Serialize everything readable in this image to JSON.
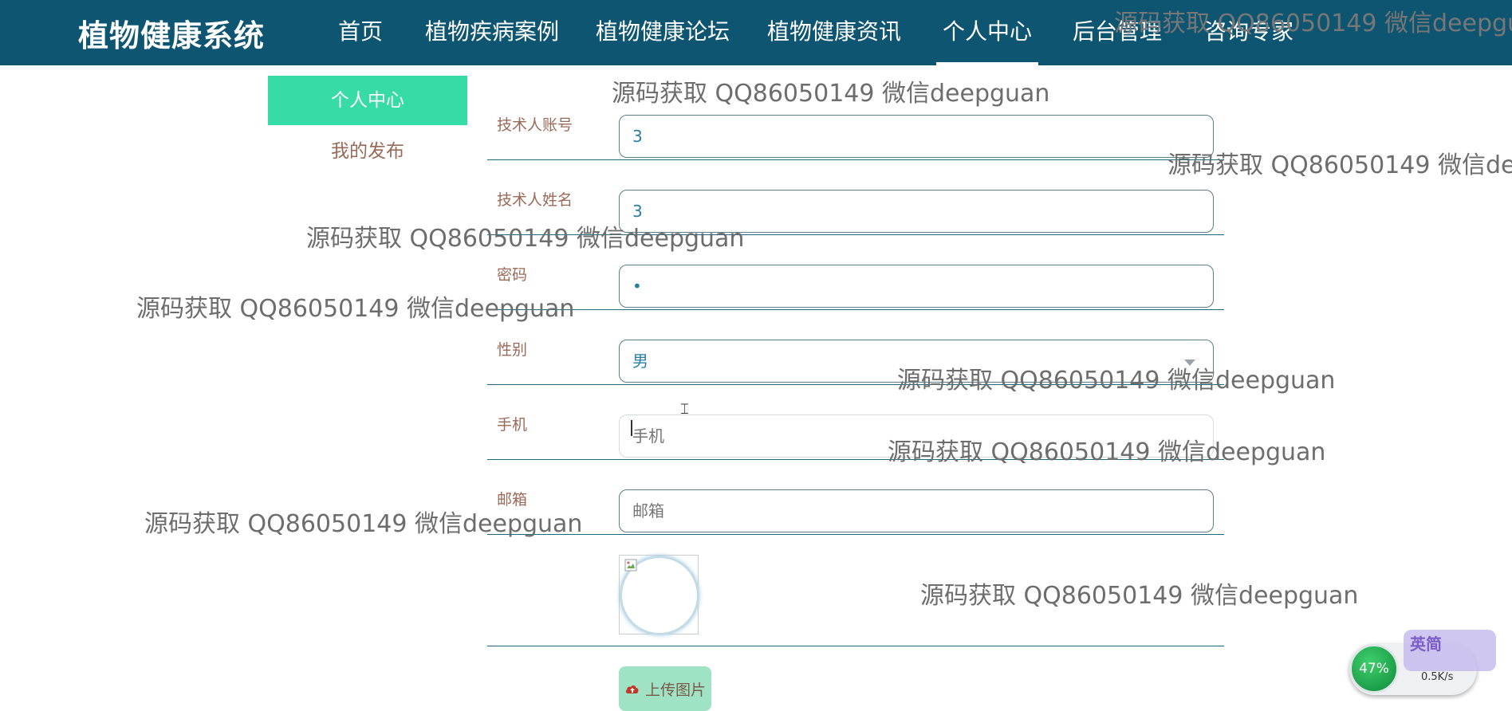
{
  "header": {
    "site_title": "植物健康系统",
    "nav": [
      {
        "label": "首页"
      },
      {
        "label": "植物疾病案例"
      },
      {
        "label": "植物健康论坛"
      },
      {
        "label": "植物健康资讯"
      },
      {
        "label": "个人中心",
        "active": true
      },
      {
        "label": "后台管理"
      },
      {
        "label": "咨询专家"
      }
    ]
  },
  "sidebar": {
    "active_label": "个人中心",
    "link_label": "我的发布"
  },
  "form": {
    "account": {
      "label": "技术人账号",
      "value": "3"
    },
    "name": {
      "label": "技术人姓名",
      "value": "3"
    },
    "password": {
      "label": "密码",
      "value": "•"
    },
    "gender": {
      "label": "性别",
      "value": "男"
    },
    "phone": {
      "label": "手机",
      "placeholder": "手机"
    },
    "email": {
      "label": "邮箱",
      "placeholder": "邮箱"
    },
    "upload_label": "上传图片"
  },
  "watermark": {
    "text": "源码获取 QQ86050149 微信deepguan"
  },
  "overlay": {
    "speed_percent": "47%",
    "speed_value": "0.5K/s",
    "ime_text": "英简"
  },
  "colors": {
    "header_bg": "#0e5572",
    "sidebar_active_bg": "#37dba5",
    "upload_button_bg": "#9fe3c4",
    "label_color": "#9a6a58",
    "value_color": "#2a7fa0"
  }
}
